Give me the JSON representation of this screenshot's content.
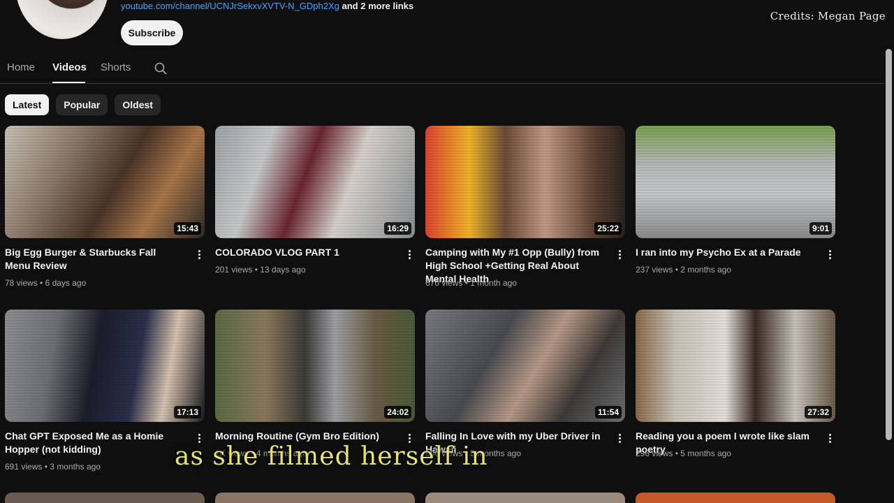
{
  "channel": {
    "link_text": "youtube.com/channel/UCNJrSekxvXVTV-N_GDph2Xg",
    "more_links": "and 2 more links",
    "subscribe_label": "Subscribe"
  },
  "credits": "Credits: Megan Page",
  "tabs": [
    {
      "label": "Home",
      "active": false
    },
    {
      "label": "Videos",
      "active": true
    },
    {
      "label": "Shorts",
      "active": false
    }
  ],
  "chips": [
    {
      "label": "Latest",
      "active": true
    },
    {
      "label": "Popular",
      "active": false
    },
    {
      "label": "Oldest",
      "active": false
    }
  ],
  "videos": [
    {
      "title": "Big Egg Burger & Starbucks Fall Menu Review",
      "views": "78 views",
      "age": "6 days ago",
      "duration": "15:43"
    },
    {
      "title": "COLORADO VLOG PART 1",
      "views": "201 views",
      "age": "13 days ago",
      "duration": "16:29"
    },
    {
      "title": "Camping with My #1 Opp (Bully) from High School +Getting Real About Mental Health",
      "views": "670 views",
      "age": "1 month ago",
      "duration": "25:22"
    },
    {
      "title": "I ran into my Psycho Ex at a Parade",
      "views": "237 views",
      "age": "2 months ago",
      "duration": "9:01"
    },
    {
      "title": "Chat GPT Exposed Me as a Homie Hopper (not kidding)",
      "views": "691 views",
      "age": "3 months ago",
      "duration": "17:13"
    },
    {
      "title": "Morning Routine (Gym Bro Edition)",
      "views": "1K views",
      "age": "4 months ago",
      "duration": "24:02"
    },
    {
      "title": "Falling In Love with my Uber Driver in Hawaii",
      "views": "906 views",
      "age": "5 months ago",
      "duration": "11:54"
    },
    {
      "title": "Reading you a poem I wrote like slam poetry",
      "views": "296 views",
      "age": "5 months ago",
      "duration": "27:32"
    }
  ],
  "caption": "as she filmed herself in",
  "colors": {
    "background": "#0f0f0f",
    "link": "#3ea6ff",
    "caption": "#e8e36a"
  }
}
